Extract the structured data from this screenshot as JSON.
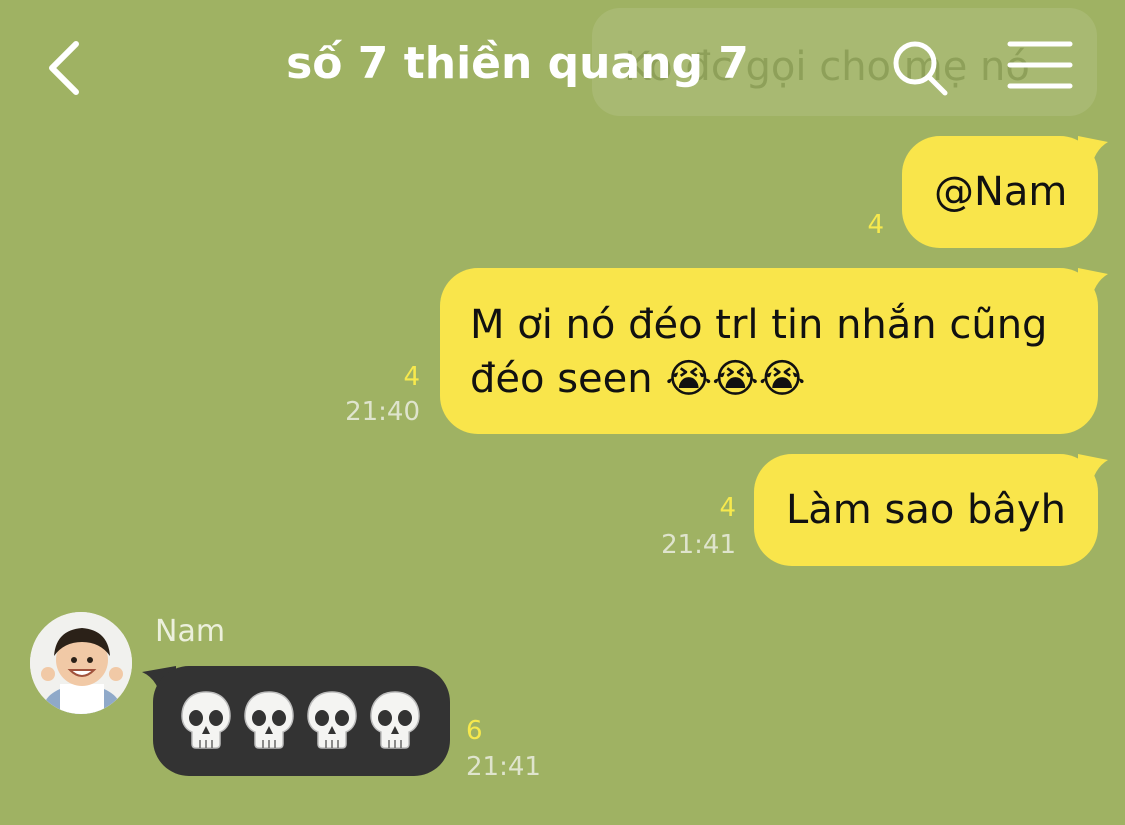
{
  "header": {
    "title": "số 7 thiền quang 7",
    "back_icon": "chevron-left-icon",
    "search_icon": "search-icon",
    "menu_icon": "hamburger-menu-icon"
  },
  "pinned_notice": {
    "text": "Ko đc gọi cho mẹ nó"
  },
  "messages": [
    {
      "direction": "outgoing",
      "text": "@Nam",
      "read_count": "4",
      "time": ""
    },
    {
      "direction": "outgoing",
      "line1": "M ơi nó đéo trl tin nhắn cũng",
      "line2": "đéo seen 😭😭😭",
      "read_count": "4",
      "time": "21:40"
    },
    {
      "direction": "outgoing",
      "text": "Làm sao bâyh",
      "read_count": "4",
      "time": "21:41"
    },
    {
      "direction": "incoming",
      "sender": "Nam",
      "content": "💀💀💀💀",
      "read_count": "6",
      "time": "21:41"
    }
  ],
  "colors": {
    "background": "#9fb263",
    "outgoing_bubble": "#f9e54b",
    "incoming_bubble": "#333333",
    "read_count": "#f7e94d",
    "timestamp": "#dfe4cd"
  }
}
